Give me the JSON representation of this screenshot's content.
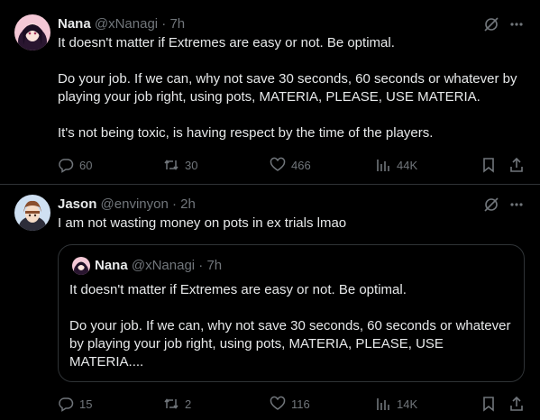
{
  "tweets": [
    {
      "name": "Nana",
      "handle": "@xNanagi",
      "sep": "·",
      "time": "7h",
      "text": [
        "It doesn't matter if Extremes are easy or not. Be optimal.",
        "Do your job. If we can, why not save 30 seconds, 60 seconds or whatever by playing your job right, using pots, MATERIA, PLEASE, USE MATERIA.",
        "It's not being toxic, is having respect by the time of the players."
      ],
      "replies": "60",
      "reposts": "30",
      "likes": "466",
      "views": "44K"
    },
    {
      "name": "Jason",
      "handle": "@envinyon",
      "sep": "·",
      "time": "2h",
      "text": [
        "I am not wasting money on pots in ex trials lmao"
      ],
      "quote": {
        "name": "Nana",
        "handle": "@xNanagi",
        "sep": "·",
        "time": "7h",
        "text": [
          "It doesn't matter if Extremes are easy or not. Be optimal.",
          "Do your job. If we can, why not save 30 seconds, 60 seconds or whatever by playing your job right, using pots, MATERIA, PLEASE, USE MATERIA...."
        ]
      },
      "replies": "15",
      "reposts": "2",
      "likes": "116",
      "views": "14K"
    }
  ],
  "icons": {
    "grok": "grok-icon",
    "more": "more-icon",
    "reply": "reply-icon",
    "repost": "repost-icon",
    "like": "heart-icon",
    "views": "views-icon",
    "bookmark": "bookmark-icon",
    "share": "share-icon"
  },
  "colors": {
    "background": "#000000",
    "text": "#e7e9ea",
    "muted": "#71767b",
    "border": "#2f3336"
  }
}
